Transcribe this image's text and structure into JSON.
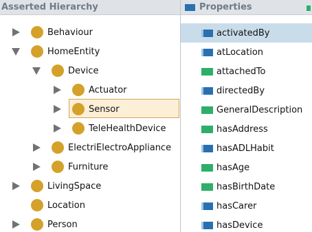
{
  "hierarchy_panel": {
    "title": "Asserted Hierarchy",
    "items": [
      {
        "label": "Behaviour",
        "state": "collapsed"
      },
      {
        "label": "HomeEntity",
        "state": "expanded"
      },
      {
        "label": "Device",
        "state": "expanded"
      },
      {
        "label": "Actuator",
        "state": "collapsed"
      },
      {
        "label": "Sensor",
        "state": "collapsed",
        "selected": true
      },
      {
        "label": "TeleHealthDevice",
        "state": "collapsed"
      },
      {
        "label": "ElectriElectroAppliance",
        "state": "collapsed"
      },
      {
        "label": "Furniture",
        "state": "collapsed"
      },
      {
        "label": "LivingSpace",
        "state": "collapsed"
      },
      {
        "label": "Location",
        "state": "leaf"
      },
      {
        "label": "Person",
        "state": "collapsed"
      }
    ]
  },
  "properties_panel": {
    "title": "Properties",
    "items": [
      {
        "label": "activatedBy",
        "kind": "object",
        "selected": true
      },
      {
        "label": "atLocation",
        "kind": "object"
      },
      {
        "label": "attachedTo",
        "kind": "data"
      },
      {
        "label": "directedBy",
        "kind": "object"
      },
      {
        "label": "GeneralDescription",
        "kind": "data"
      },
      {
        "label": "hasAddress",
        "kind": "data"
      },
      {
        "label": "hasADLHabit",
        "kind": "object"
      },
      {
        "label": "hasAge",
        "kind": "data"
      },
      {
        "label": "hasBirthDate",
        "kind": "data"
      },
      {
        "label": "hasCarer",
        "kind": "object"
      },
      {
        "label": "hasDevice",
        "kind": "object"
      }
    ]
  },
  "colors": {
    "header_bg": "#dfe3e8",
    "class_dot": "#d4a12a",
    "object_property": "#2a6fb0",
    "data_property": "#2eae6a",
    "selected_class_bg": "#fcefd7",
    "selected_property_bg": "#c9dcea"
  }
}
